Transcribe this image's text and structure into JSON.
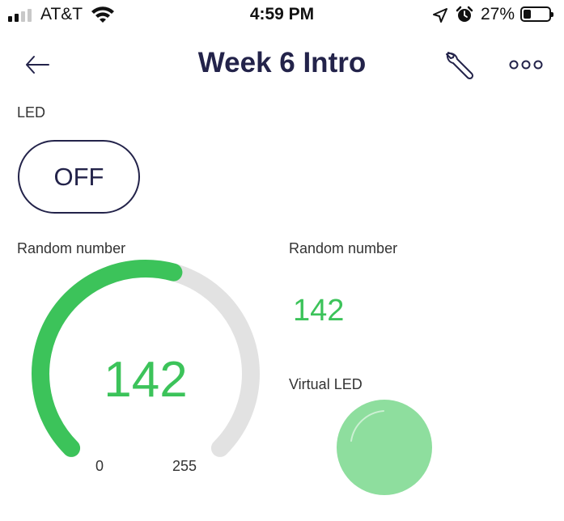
{
  "status_bar": {
    "carrier": "AT&T",
    "time": "4:59 PM",
    "battery_percent": "27%",
    "battery_level": 0.27
  },
  "header": {
    "title": "Week 6 Intro",
    "back_icon": "arrow-left-icon",
    "settings_icon": "wrench-icon",
    "more_icon": "more-dots-icon"
  },
  "led_switch": {
    "label": "LED",
    "state_text": "OFF"
  },
  "gauge": {
    "label": "Random number",
    "value": 142,
    "value_text": "142",
    "min": 0,
    "max": 255,
    "min_text": "0",
    "max_text": "255",
    "color": "#3cc35a",
    "track_color": "#e2e2e2"
  },
  "value_display": {
    "label": "Random number",
    "value_text": "142",
    "color": "#3cc35a"
  },
  "virtual_led": {
    "label": "Virtual LED",
    "color": "#8ede9e",
    "brightness": 0.557
  }
}
